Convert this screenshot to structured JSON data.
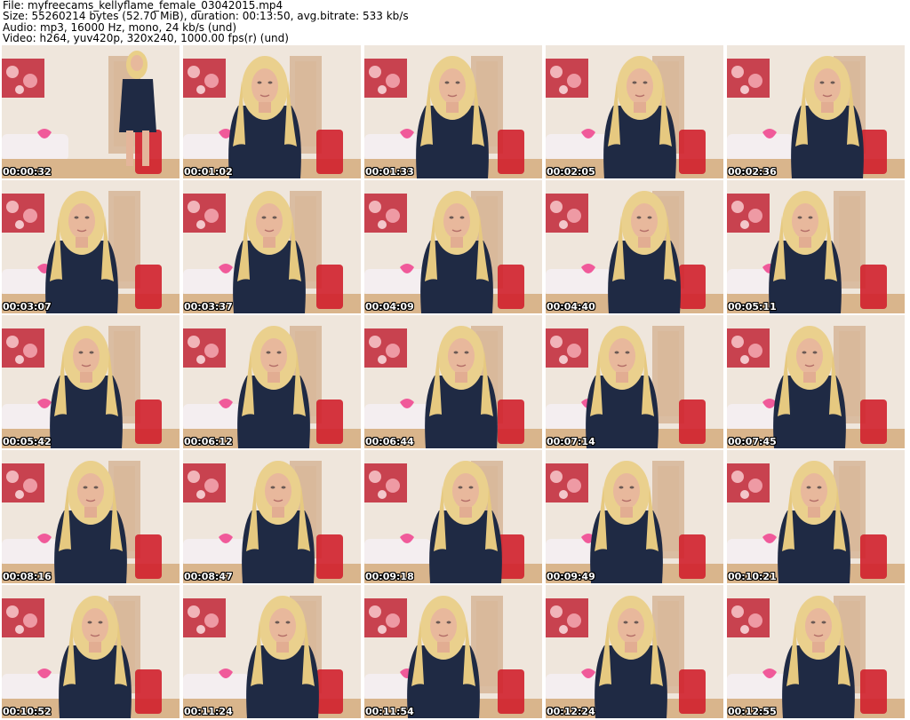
{
  "header": {
    "line1": "File: myfreecams_kellyflame_female_03042015.mp4",
    "line2": "Size: 55260214 bytes (52.70 MiB), duration: 00:13:50, avg.bitrate: 533 kb/s",
    "line3": "Audio: mp3, 16000 Hz, mono, 24 kb/s (und)",
    "line4": "Video: h264, yuv420p, 320x240, 1000.00 fps(r) (und)"
  },
  "thumbnails": [
    {
      "timestamp": "00:00:32"
    },
    {
      "timestamp": "00:01:02"
    },
    {
      "timestamp": "00:01:33"
    },
    {
      "timestamp": "00:02:05"
    },
    {
      "timestamp": "00:02:36"
    },
    {
      "timestamp": "00:03:07"
    },
    {
      "timestamp": "00:03:37"
    },
    {
      "timestamp": "00:04:09"
    },
    {
      "timestamp": "00:04:40"
    },
    {
      "timestamp": "00:05:11"
    },
    {
      "timestamp": "00:05:42"
    },
    {
      "timestamp": "00:06:12"
    },
    {
      "timestamp": "00:06:44"
    },
    {
      "timestamp": "00:07:14"
    },
    {
      "timestamp": "00:07:45"
    },
    {
      "timestamp": "00:08:16"
    },
    {
      "timestamp": "00:08:47"
    },
    {
      "timestamp": "00:09:18"
    },
    {
      "timestamp": "00:09:49"
    },
    {
      "timestamp": "00:10:21"
    },
    {
      "timestamp": "00:10:52"
    },
    {
      "timestamp": "00:11:24"
    },
    {
      "timestamp": "00:11:54"
    },
    {
      "timestamp": "00:12:24"
    },
    {
      "timestamp": "00:12:55"
    }
  ]
}
